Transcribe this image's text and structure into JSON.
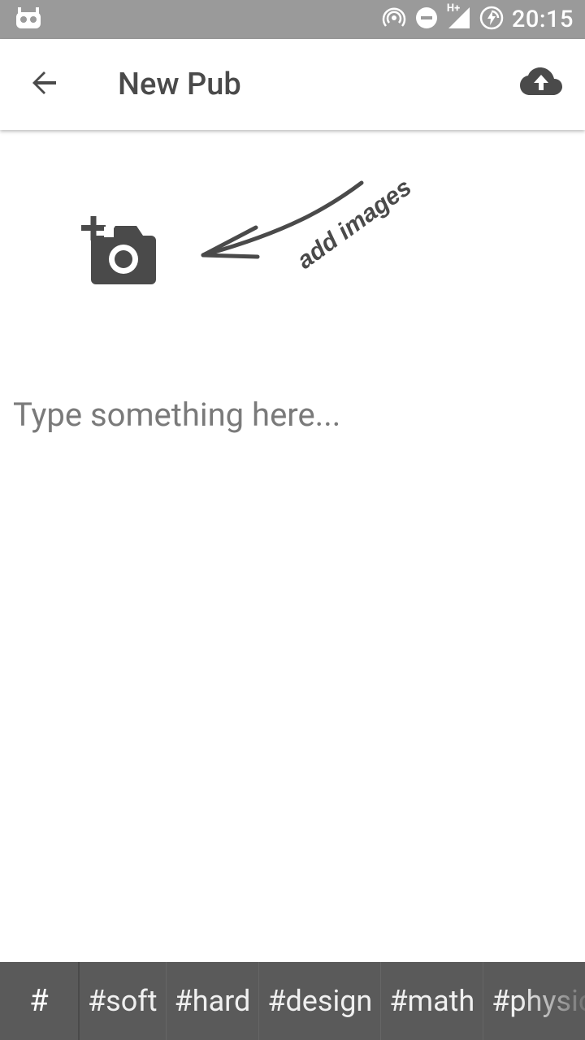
{
  "status_bar": {
    "time": "20:15",
    "network_label": "H+",
    "icons": [
      "android-debug-icon",
      "hotspot-icon",
      "do-not-disturb-icon",
      "signal-icon",
      "battery-charging-icon"
    ]
  },
  "app_bar": {
    "title": "New Pub",
    "back_icon": "arrow-back-icon",
    "upload_icon": "cloud-upload-icon"
  },
  "content": {
    "add_images_hint": "add images",
    "add_photo_icon": "add-a-photo-icon",
    "input": {
      "value": "",
      "placeholder": "Type something here..."
    }
  },
  "tag_bar": {
    "hash_label": "#",
    "tags": [
      "#soft",
      "#hard",
      "#design",
      "#math",
      "#physics"
    ]
  },
  "colors": {
    "status_bar": "#9a9a9a",
    "tag_bar": "#5a5a5a",
    "icon": "#4a4a4a"
  }
}
